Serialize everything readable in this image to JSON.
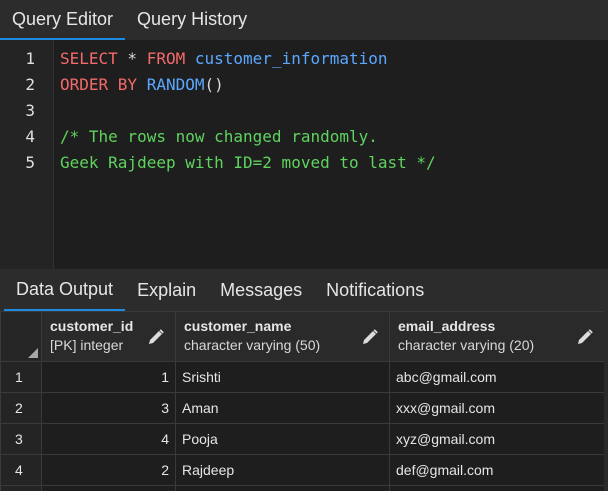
{
  "query_tabs": [
    {
      "label": "Query Editor",
      "active": true
    },
    {
      "label": "Query History",
      "active": false
    }
  ],
  "editor": {
    "line_numbers": [
      "1",
      "2",
      "3",
      "4",
      "5"
    ],
    "lines": [
      [
        {
          "t": "SELECT",
          "c": "kw"
        },
        {
          "t": " * ",
          "c": "op"
        },
        {
          "t": "FROM",
          "c": "kw"
        },
        {
          "t": " customer_information",
          "c": "id"
        }
      ],
      [
        {
          "t": "ORDER BY",
          "c": "kw"
        },
        {
          "t": " RANDOM",
          "c": "fn"
        },
        {
          "t": "()",
          "c": "op"
        }
      ],
      [],
      [
        {
          "t": "/* The rows now changed randomly.",
          "c": "cm"
        }
      ],
      [
        {
          "t": "Geek Rajdeep with ID=2 moved to last */",
          "c": "cm"
        }
      ]
    ],
    "colors": {
      "keyword": "#f46a6a",
      "identifier": "#5aa8ff",
      "comment": "#5fd35f"
    }
  },
  "output_tabs": [
    {
      "label": "Data Output",
      "active": true
    },
    {
      "label": "Explain",
      "active": false
    },
    {
      "label": "Messages",
      "active": false
    },
    {
      "label": "Notifications",
      "active": false
    }
  ],
  "grid": {
    "columns": [
      {
        "name": "customer_id",
        "type": "[PK] integer",
        "align": "num",
        "icon": "pencil-icon"
      },
      {
        "name": "customer_name",
        "type": "character varying (50)",
        "align": "text",
        "icon": "pencil-icon"
      },
      {
        "name": "email_address",
        "type": "character varying (20)",
        "align": "text",
        "icon": "pencil-icon"
      }
    ],
    "rows": [
      {
        "num": "1",
        "cells": [
          "1",
          "Srishti",
          "abc@gmail.com"
        ]
      },
      {
        "num": "2",
        "cells": [
          "3",
          "Aman",
          "xxx@gmail.com"
        ]
      },
      {
        "num": "3",
        "cells": [
          "4",
          "Pooja",
          "xyz@gmail.com"
        ]
      },
      {
        "num": "4",
        "cells": [
          "2",
          "Rajdeep",
          "def@gmail.com"
        ]
      }
    ],
    "accent": "#1d8be1"
  }
}
